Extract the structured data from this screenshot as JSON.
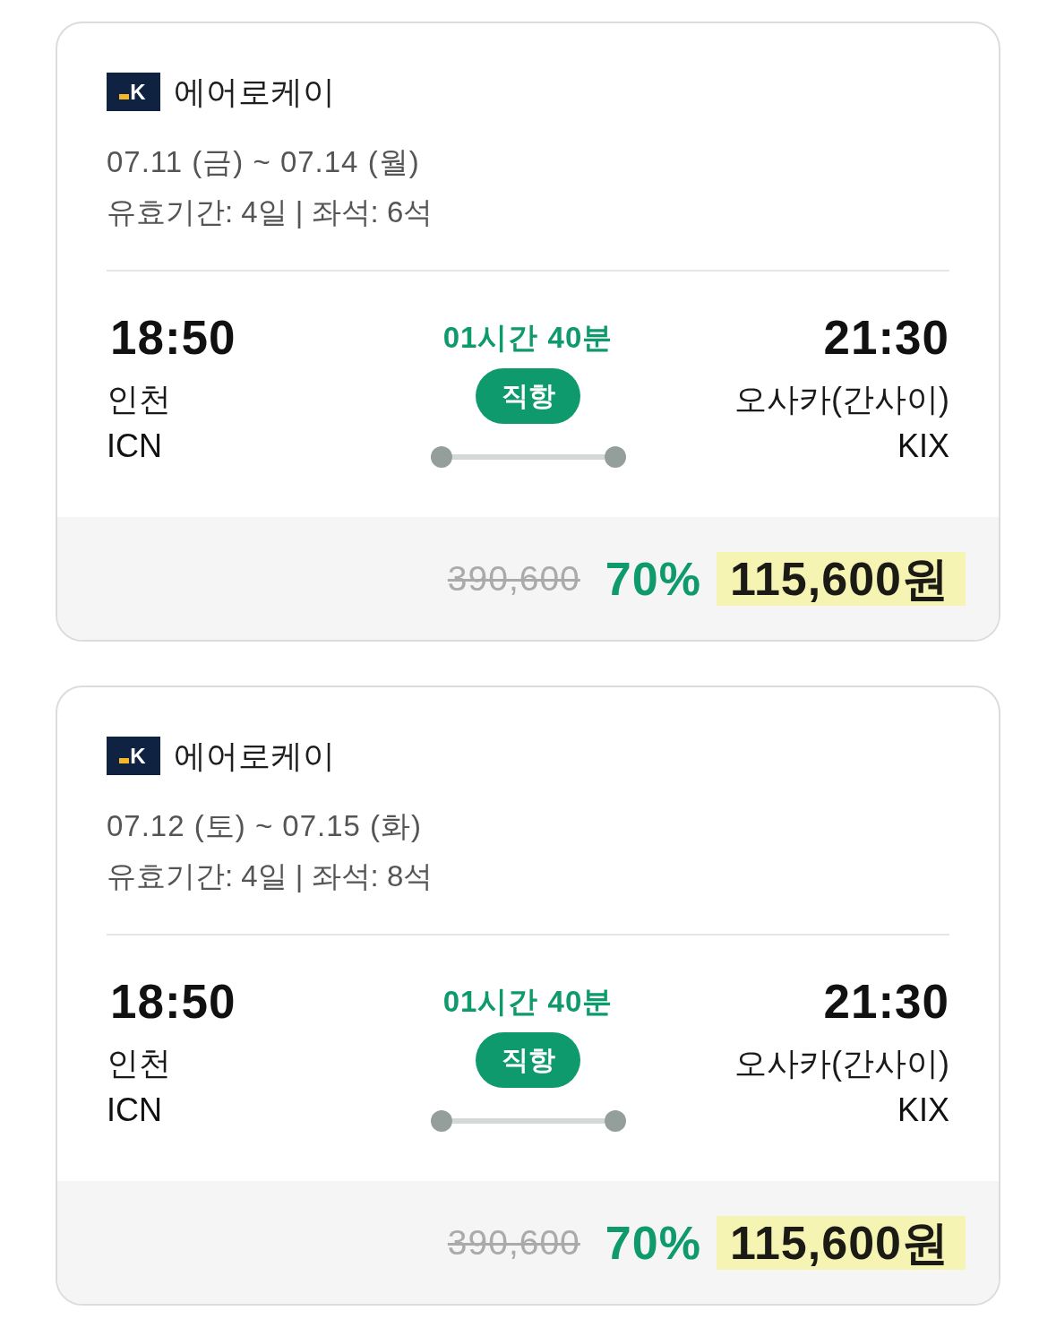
{
  "flights": [
    {
      "airline": {
        "logo": "K",
        "name": "에어로케이"
      },
      "dates": "07.11 (금) ~ 07.14 (월)",
      "info": "유효기간: 4일 | 좌석: 6석",
      "departure": {
        "time": "18:50",
        "city": "인천",
        "code": "ICN"
      },
      "duration": "01시간 40분",
      "badge": "직항",
      "arrival": {
        "time": "21:30",
        "city": "오사카(간사이)",
        "code": "KIX"
      },
      "price": {
        "original": "390,600",
        "discount": "70%",
        "final": "115,600원"
      }
    },
    {
      "airline": {
        "logo": "K",
        "name": "에어로케이"
      },
      "dates": "07.12 (토) ~ 07.15 (화)",
      "info": "유효기간: 4일 | 좌석: 8석",
      "departure": {
        "time": "18:50",
        "city": "인천",
        "code": "ICN"
      },
      "duration": "01시간 40분",
      "badge": "직항",
      "arrival": {
        "time": "21:30",
        "city": "오사카(간사이)",
        "code": "KIX"
      },
      "price": {
        "original": "390,600",
        "discount": "70%",
        "final": "115,600원"
      }
    }
  ]
}
